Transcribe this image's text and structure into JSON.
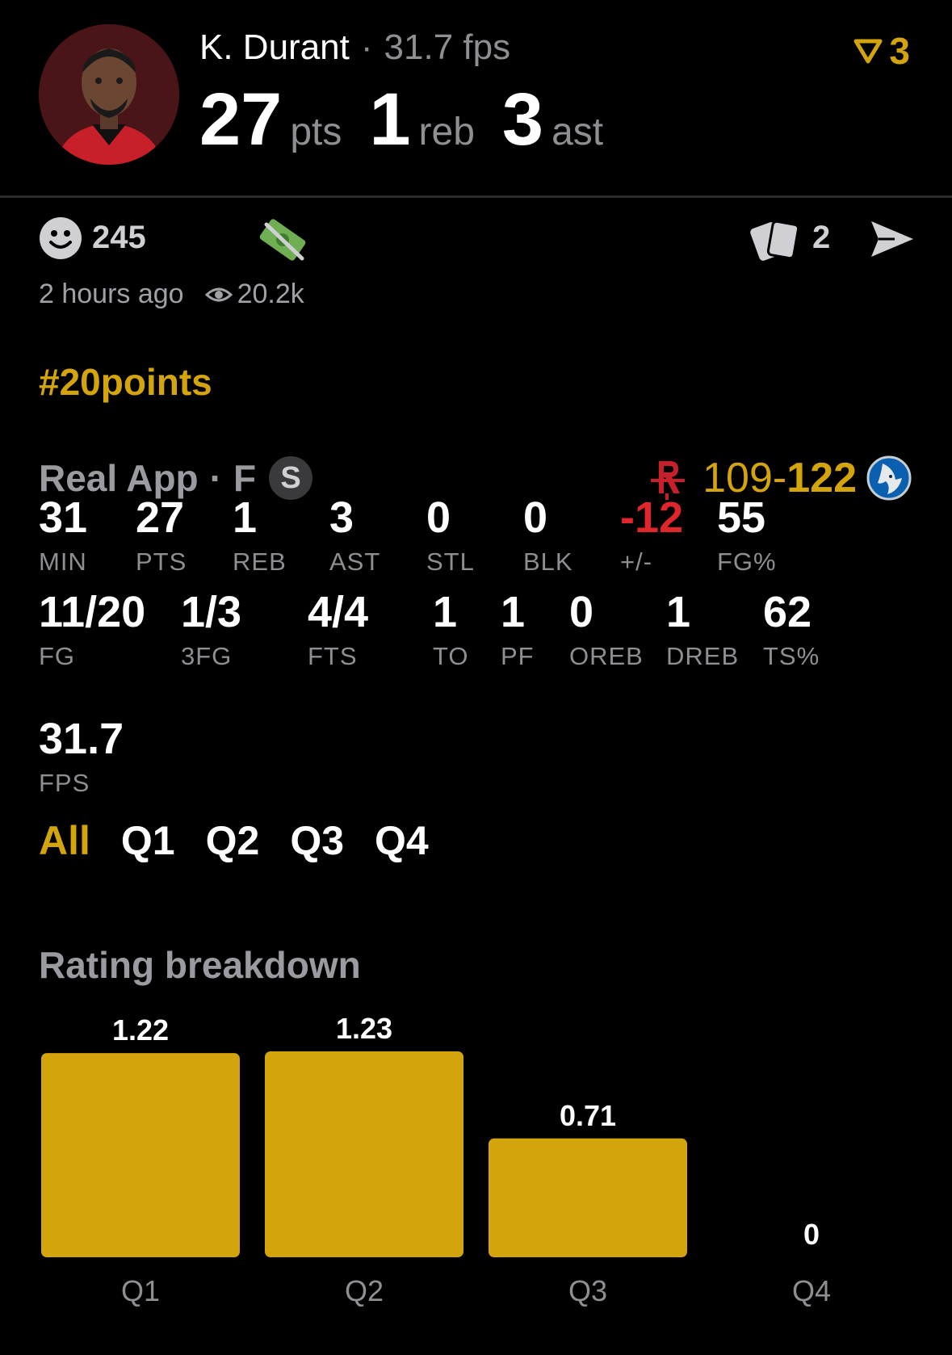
{
  "header": {
    "player_name": "K. Durant",
    "fps_summary": "31.7 fps",
    "points": "27",
    "points_unit": "pts",
    "rebounds": "1",
    "rebounds_unit": "reb",
    "assists": "3",
    "assists_unit": "ast",
    "rank_count": "3",
    "rank_icon": "filter-funnel-icon",
    "avatar": "player-avatar-rockets-jersey"
  },
  "reactions": {
    "emoji_icon": "smiley-face-icon",
    "emoji_count": "245",
    "money_icon": "money-bill-icon",
    "cards_icon": "cards-icon",
    "cards_count": "2",
    "send_icon": "send-icon"
  },
  "meta": {
    "time_ago": "2 hours ago",
    "views": "20.2k"
  },
  "hashtag": "#20points",
  "game": {
    "source": "Real App",
    "position": "F",
    "badge": "S",
    "team_score": "109",
    "dash": "-",
    "opponent_score": "122"
  },
  "stats": [
    {
      "value": "31",
      "label": "MIN"
    },
    {
      "value": "27",
      "label": "PTS"
    },
    {
      "value": "1",
      "label": "REB"
    },
    {
      "value": "3",
      "label": "AST"
    },
    {
      "value": "0",
      "label": "STL"
    },
    {
      "value": "0",
      "label": "BLK"
    },
    {
      "value": "-12",
      "label": "+/-"
    },
    {
      "value": "55",
      "label": "FG%"
    },
    {
      "value": "11/20",
      "label": "FG"
    },
    {
      "value": "1/3",
      "label": "3FG"
    },
    {
      "value": "4/4",
      "label": "FTS"
    },
    {
      "value": "1",
      "label": "TO"
    },
    {
      "value": "1",
      "label": "PF"
    },
    {
      "value": "0",
      "label": "OREB"
    },
    {
      "value": "1",
      "label": "DREB"
    },
    {
      "value": "62",
      "label": "TS%"
    },
    {
      "value": "31.7",
      "label": "FPS"
    }
  ],
  "tabs": [
    "All",
    "Q1",
    "Q2",
    "Q3",
    "Q4"
  ],
  "active_tab": "All",
  "colors": {
    "accent": "#d4a40d",
    "negative": "#e0262a",
    "muted": "#8e8e93",
    "background": "#000000"
  },
  "chart_title": "Rating breakdown",
  "chart_data": {
    "type": "bar",
    "categories": [
      "Q1",
      "Q2",
      "Q3",
      "Q4"
    ],
    "values": [
      1.22,
      1.23,
      0.71,
      0
    ],
    "value_labels": [
      "1.22",
      "1.23",
      "0.71",
      "0"
    ],
    "ylim": [
      0,
      1.23
    ]
  }
}
